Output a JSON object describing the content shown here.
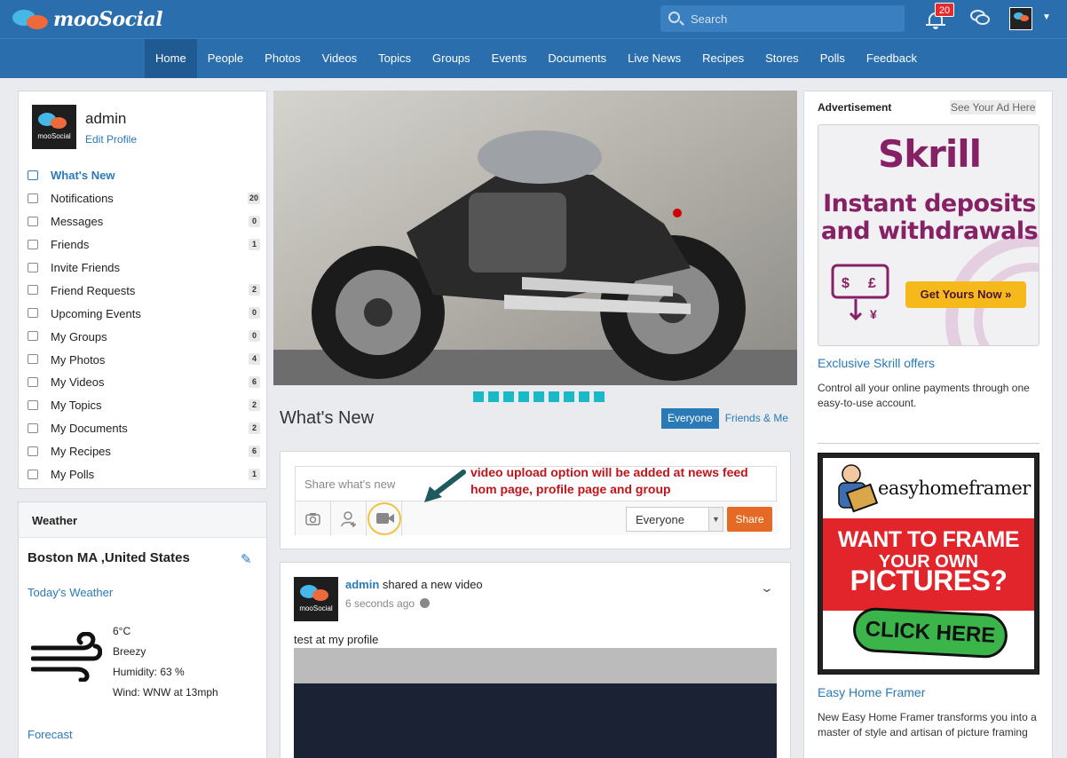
{
  "app": {
    "logo_text": "mooSocial"
  },
  "header": {
    "search_placeholder": "Search",
    "notification_count": "20",
    "avatar_label": "mooSocial"
  },
  "nav": {
    "items": [
      "Home",
      "People",
      "Photos",
      "Videos",
      "Topics",
      "Groups",
      "Events",
      "Documents",
      "Live News",
      "Recipes",
      "Stores",
      "Polls",
      "Feedback"
    ],
    "active": "Home"
  },
  "profile": {
    "name": "admin",
    "edit_label": "Edit Profile",
    "avatar_label": "mooSocial",
    "menu": [
      {
        "label": "What's New",
        "icon": "news-icon",
        "count": ""
      },
      {
        "label": "Notifications",
        "icon": "bell-icon",
        "count": "20"
      },
      {
        "label": "Messages",
        "icon": "envelope-icon",
        "count": "0"
      },
      {
        "label": "Friends",
        "icon": "friends-icon",
        "count": "1"
      },
      {
        "label": "Invite Friends",
        "icon": "share-icon",
        "count": ""
      },
      {
        "label": "Friend Requests",
        "icon": "add-user-icon",
        "count": "2"
      },
      {
        "label": "Upcoming Events",
        "icon": "calendar-icon",
        "count": "0"
      },
      {
        "label": "My Groups",
        "icon": "group-icon",
        "count": "0"
      },
      {
        "label": "My Photos",
        "icon": "photo-icon",
        "count": "4"
      },
      {
        "label": "My Videos",
        "icon": "video-icon",
        "count": "6"
      },
      {
        "label": "My Topics",
        "icon": "topic-icon",
        "count": "2"
      },
      {
        "label": "My Documents",
        "icon": "document-icon",
        "count": "2"
      },
      {
        "label": "My Recipes",
        "icon": "fork-knife-icon",
        "count": "6"
      },
      {
        "label": "My Polls",
        "icon": "poll-icon",
        "count": "1"
      }
    ]
  },
  "weather": {
    "title": "Weather",
    "city": "Boston MA ,United States",
    "today_label": "Today's Weather",
    "temp": "6°C",
    "condition": "Breezy",
    "humidity": "Humidity: 63 %",
    "wind": "Wind: WNW at 13mph",
    "forecast_label": "Forecast"
  },
  "feed": {
    "title": "What's New",
    "tabs": [
      "Everyone",
      "Friends & Me"
    ],
    "active_tab": "Everyone",
    "slider_dots": 9,
    "share_placeholder": "Share what's new",
    "privacy_value": "Everyone",
    "share_button": "Share",
    "annotation": "video upload option will be added at  news feed hom page, profile page and group"
  },
  "post": {
    "author": "admin",
    "action": " shared a new video",
    "time": "6 seconds ago",
    "text": "test at my profile",
    "avatar_label": "mooSocial"
  },
  "ads": {
    "label": "Advertisement",
    "see_your_ad": "See Your Ad Here",
    "items": [
      {
        "brand": "Skrill",
        "headline": "Instant deposits and withdrawals",
        "cta": "Get Yours Now »",
        "title": "Exclusive Skrill offers",
        "description": "Control all your online payments through one easy-to-use account."
      },
      {
        "brand": "easyhomeframer",
        "line1": "WANT TO FRAME",
        "line2": "YOUR OWN",
        "line3": "PICTURES?",
        "cta": "CLICK HERE",
        "title": "Easy Home Framer",
        "description": "New Easy Home Framer transforms you into a master of style and artisan of picture framing"
      }
    ]
  },
  "colors": {
    "header_bg": "#2a6ead",
    "nav_active": "#1f5a93",
    "link": "#2a7ab8",
    "share_button": "#e46a25",
    "slider_dot": "#19b9c8",
    "annotation": "#c0141b",
    "skrill": "#862165"
  }
}
